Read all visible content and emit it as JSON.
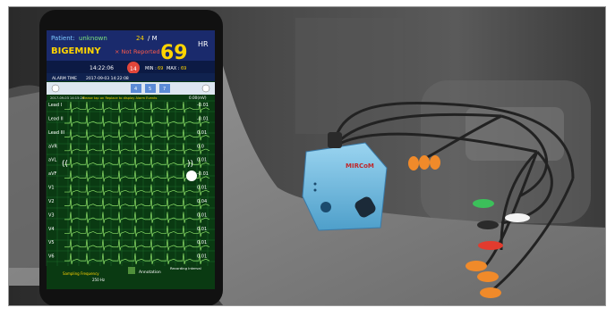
{
  "phone": {
    "patient_label": "Patient:",
    "patient_value": "unknown",
    "age_text": "24",
    "gender_text": "/ M",
    "hr_label": "HR",
    "rhythm": "BIGEMINY",
    "status": "× Not Reported",
    "hr_value": "69",
    "time": "14:22:06",
    "alarm_badge": "14",
    "min_label": "MIN :",
    "min_value": "69",
    "max_label": "MAX :",
    "max_value": "69",
    "alarm_time_label": "ALARM TIME",
    "alarm_time_value": "2017-09-03 14:22:08",
    "alarm_counts": [
      "4",
      "5",
      "7"
    ],
    "record_time": "2017-09-03 14:15:24",
    "hint": "Please tap on Replace to display Alarm Events",
    "unit": "0.00(mV)",
    "leads": [
      {
        "name": "Lead I",
        "value": "-0.01"
      },
      {
        "name": "Lead II",
        "value": "-0.01"
      },
      {
        "name": "Lead III",
        "value": "0.01"
      },
      {
        "name": "aVR",
        "value": "0.0"
      },
      {
        "name": "aVL",
        "value": "0.01"
      },
      {
        "name": "aVF",
        "value": "-0.01"
      },
      {
        "name": "V1",
        "value": "0.01"
      },
      {
        "name": "V2",
        "value": "0.04"
      },
      {
        "name": "V3",
        "value": "0.01"
      },
      {
        "name": "V4",
        "value": "0.01"
      },
      {
        "name": "V5",
        "value": "0.01"
      },
      {
        "name": "V6",
        "value": "0.01"
      }
    ],
    "footer_left": "Sampling Frequency",
    "footer_left_value": "250 Hz",
    "footer_mid": "Annotation",
    "footer_right": "Recording Interval"
  },
  "device": {
    "brand": "MIRCoM"
  },
  "colors": {
    "screen_bg": "#0a3a12",
    "trace": "#8fe36a",
    "grid": "#1c6a2a",
    "header_bg": "#1a2a6c",
    "accent_yellow": "#ffd400",
    "device_blue": "#7cc3e6",
    "lead_orange": "#f08a2a",
    "lead_green": "#3cc05a",
    "lead_red": "#e23b2e"
  }
}
